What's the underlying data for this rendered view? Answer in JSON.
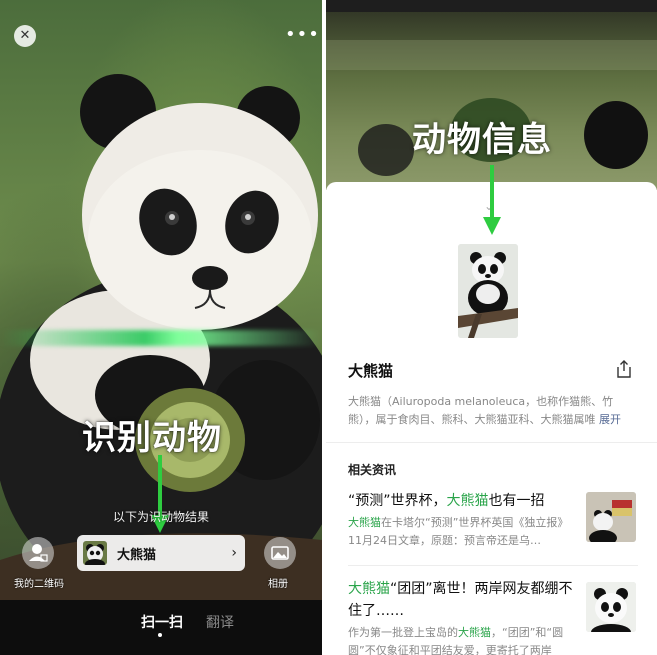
{
  "left_screen": {
    "close_icon": "close-icon",
    "more_icon": "more-icon",
    "overlay_caption": "识别动物",
    "result_hint": "以下为识动物结果",
    "result_card": {
      "name": "大熊猫",
      "chevron": "›"
    },
    "qr_label": "我的二维码",
    "album_label": "相册",
    "tabs": [
      {
        "label": "扫一扫",
        "active": true
      },
      {
        "label": "翻译",
        "active": false
      }
    ],
    "colors": {
      "scan_line": "#28c85a",
      "arrow": "#2ecc40"
    }
  },
  "right_screen": {
    "overlay_caption": "动物信息",
    "handle_icon": "chevron-down-icon",
    "title": "大熊猫",
    "share_icon": "share-icon",
    "description": "大熊猫（Ailuropoda melanoleuca，也称作猫熊、竹熊），属于食肉目、熊科、大熊猫亚科、大熊猫属唯",
    "description_more": "展开",
    "section_title": "相关资讯",
    "news": [
      {
        "title_pre": "“预测”世界杯，",
        "title_hl": "大熊猫",
        "title_post": "也有一招",
        "summary_hl": "大熊猫",
        "summary_rest": "在卡塔尔“预测”世界杯英国《独立报》11月24日文章，原题：预言帝还是乌…"
      },
      {
        "title_hl": "大熊猫",
        "title_rest": "“团团”离世！两岸网友都绷不住了……",
        "summary_pre": "作为第一批登上宝岛的",
        "summary_hl": "大熊猫",
        "summary_rest": "，“团团”和“圆圆”不仅象征和平团结友爱，更寄托了两岸"
      }
    ],
    "colors": {
      "highlight": "#2aa44a",
      "link": "#576b95"
    }
  }
}
